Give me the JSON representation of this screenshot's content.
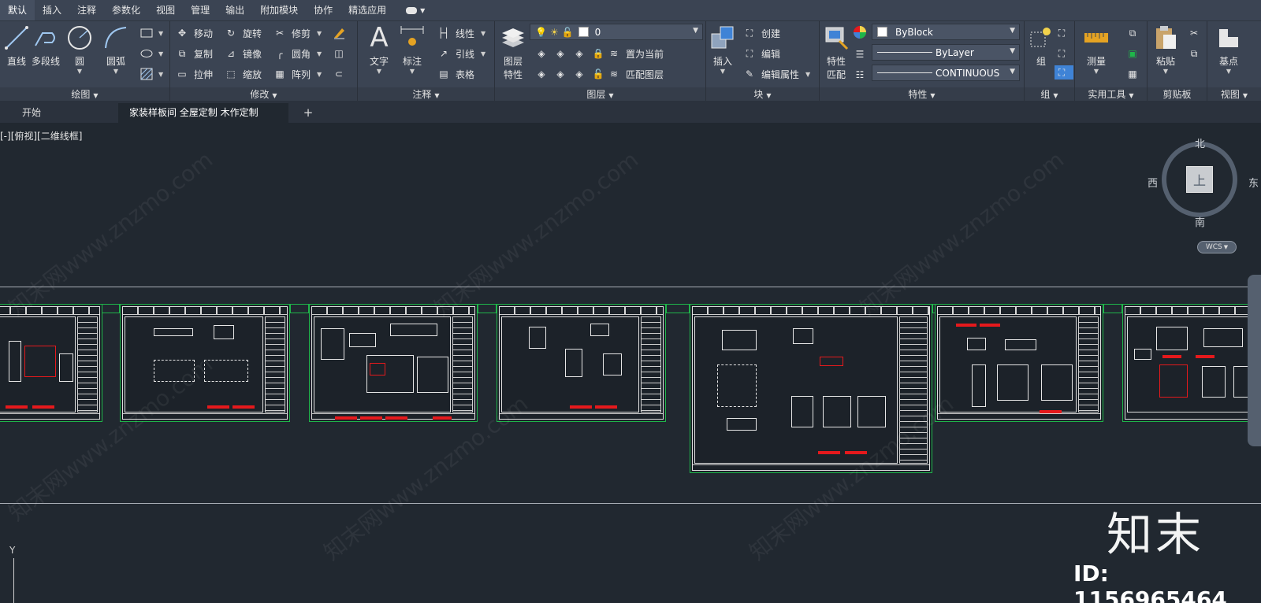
{
  "menu": {
    "tabs": [
      "默认",
      "插入",
      "注释",
      "参数化",
      "视图",
      "管理",
      "输出",
      "附加模块",
      "协作",
      "精选应用"
    ],
    "active_tab": "默认"
  },
  "ribbon": {
    "draw": {
      "title": "绘图",
      "tools": [
        "直线",
        "多段线",
        "圆",
        "圆弧"
      ]
    },
    "modify": {
      "title": "修改",
      "tools": [
        "移动",
        "旋转",
        "修剪",
        "复制",
        "镜像",
        "圆角",
        "拉伸",
        "缩放",
        "阵列"
      ]
    },
    "annotation": {
      "title": "注释",
      "tools": [
        "文字",
        "标注",
        "线性",
        "引线",
        "表格"
      ]
    },
    "layers": {
      "title": "图层",
      "big_tool": "图层\n特性",
      "big_tool_line1": "图层",
      "big_tool_line2": "特性",
      "current_layer": "0",
      "tools": [
        "置为当前",
        "匹配图层"
      ]
    },
    "block": {
      "title": "块",
      "insert": "插入",
      "tools": [
        "创建",
        "编辑",
        "编辑属性"
      ]
    },
    "properties": {
      "title": "特性",
      "match_line1": "特性",
      "match_line2": "匹配",
      "color": "ByBlock",
      "lineweight": "ByLayer",
      "linetype": "CONTINUOUS"
    },
    "groups": {
      "title": "组",
      "tool": "组"
    },
    "utilities": {
      "title": "实用工具",
      "tool": "测量"
    },
    "clipboard": {
      "title": "剪贴板",
      "tool": "粘贴"
    },
    "view": {
      "title": "视图",
      "tool": "基点"
    }
  },
  "file_tabs": {
    "start": "开始",
    "current": "家装样板间 全屋定制 木作定制*",
    "close_glyph": "✕",
    "add_glyph": "+"
  },
  "viewport": {
    "label": "[-][俯视][二维线框]",
    "viewcube": {
      "north": "北",
      "south": "南",
      "west": "西",
      "east": "东",
      "face": "上"
    },
    "wcs": "WCS",
    "ucs_axis": "Y"
  },
  "watermark": {
    "brand": "知末",
    "id": "ID: 1156965464",
    "tiled": "知末网www.znzmo.com"
  },
  "colors": {
    "ribbon_bg": "#3b4453",
    "canvas_bg": "#212830",
    "sheet_border": "#1fb54a",
    "title_block_red": "#e5191c"
  }
}
